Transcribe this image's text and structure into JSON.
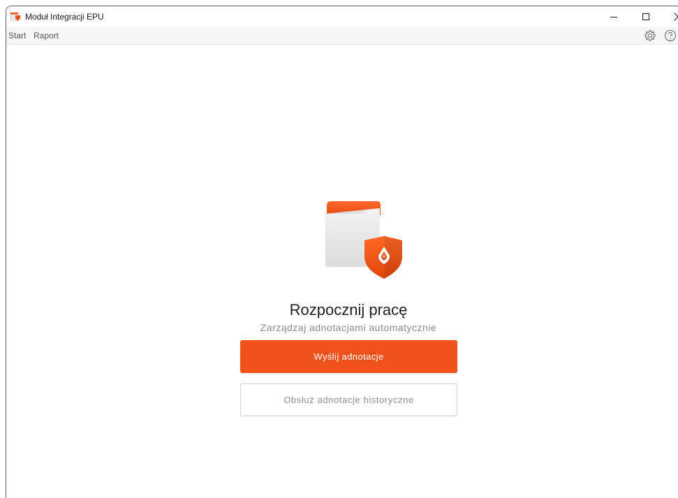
{
  "window": {
    "title": "Moduł Integracji EPU",
    "controls": {
      "minimize": "minimize-icon",
      "maximize": "maximize-icon",
      "close": "close-icon"
    }
  },
  "menu": {
    "items": [
      {
        "label": "Start"
      },
      {
        "label": "Raport"
      }
    ],
    "icons": {
      "settings": "gear-icon",
      "help": "help-icon"
    }
  },
  "main": {
    "illustration": "folder-shield-pen-icon",
    "heading": "Rozpocznij pracę",
    "subheading": "Zarządzaj adnotacjami automatycznie",
    "primary_button": "Wyślij adnotacje",
    "secondary_button": "Obsłuż adnotacje historyczne"
  },
  "colors": {
    "accent": "#f05219",
    "accent_dark": "#d9420f",
    "menubar_bg": "#f7f7f7",
    "text_muted": "#8a8a8a"
  }
}
